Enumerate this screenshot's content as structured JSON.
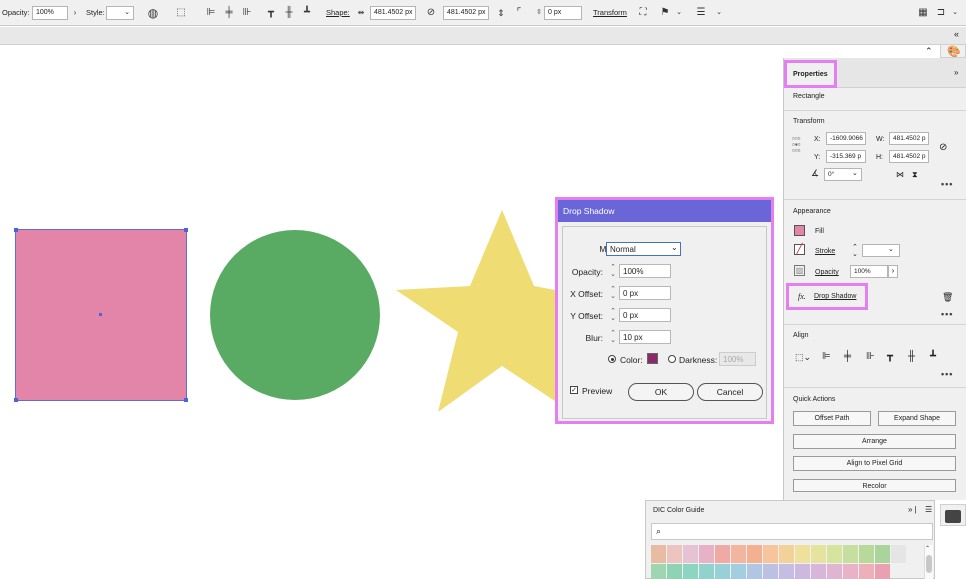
{
  "control_bar": {
    "opacity_label": "Opacity:",
    "opacity_value": "100%",
    "style_label": "Style:",
    "shape_label": "Shape:",
    "width_value": "481.4502 px",
    "height_value": "481.4502 px",
    "corner_value": "0 px",
    "transform_label": "Transform"
  },
  "drop_shadow_dialog": {
    "title": "Drop Shadow",
    "mode_label": "Mode:",
    "mode_value": "Normal",
    "opacity_label": "Opacity:",
    "opacity_value": "100%",
    "x_offset_label": "X Offset:",
    "x_offset_value": "0 px",
    "y_offset_label": "Y Offset:",
    "y_offset_value": "0 px",
    "blur_label": "Blur:",
    "blur_value": "10 px",
    "color_label": "Color:",
    "color_swatch": "#8b2a6a",
    "darkness_label": "Darkness:",
    "darkness_value": "100%",
    "preview_label": "Preview",
    "ok_label": "OK",
    "cancel_label": "Cancel"
  },
  "properties": {
    "tab_label": "Properties",
    "object_type": "Rectangle",
    "transform": {
      "header": "Transform",
      "x_label": "X:",
      "x_value": "-1609.9066",
      "y_label": "Y:",
      "y_value": "-315.369 p",
      "w_label": "W:",
      "w_value": "481.4502 p",
      "h_label": "H:",
      "h_value": "481.4502 p",
      "angle_value": "0°"
    },
    "appearance": {
      "header": "Appearance",
      "fill_label": "Fill",
      "stroke_label": "Stroke",
      "opacity_label": "Opacity",
      "opacity_value": "100%",
      "fx_label": "fx.",
      "effect_label": "Drop Shadow"
    },
    "align": {
      "header": "Align"
    },
    "quick_actions": {
      "header": "Quick Actions",
      "offset_path": "Offset Path",
      "expand_shape": "Expand Shape",
      "arrange": "Arrange",
      "align_pixel_grid": "Align to Pixel Grid",
      "recolor": "Recolor"
    }
  },
  "dic_panel": {
    "title": "DIC Color Guide"
  },
  "colors": {
    "rectangle_fill": "#e285a8",
    "circle_fill": "#59aa63",
    "star_fill": "#efdc72",
    "highlight": "#e37ff0",
    "dialog_title_bg": "#6b66d8"
  }
}
